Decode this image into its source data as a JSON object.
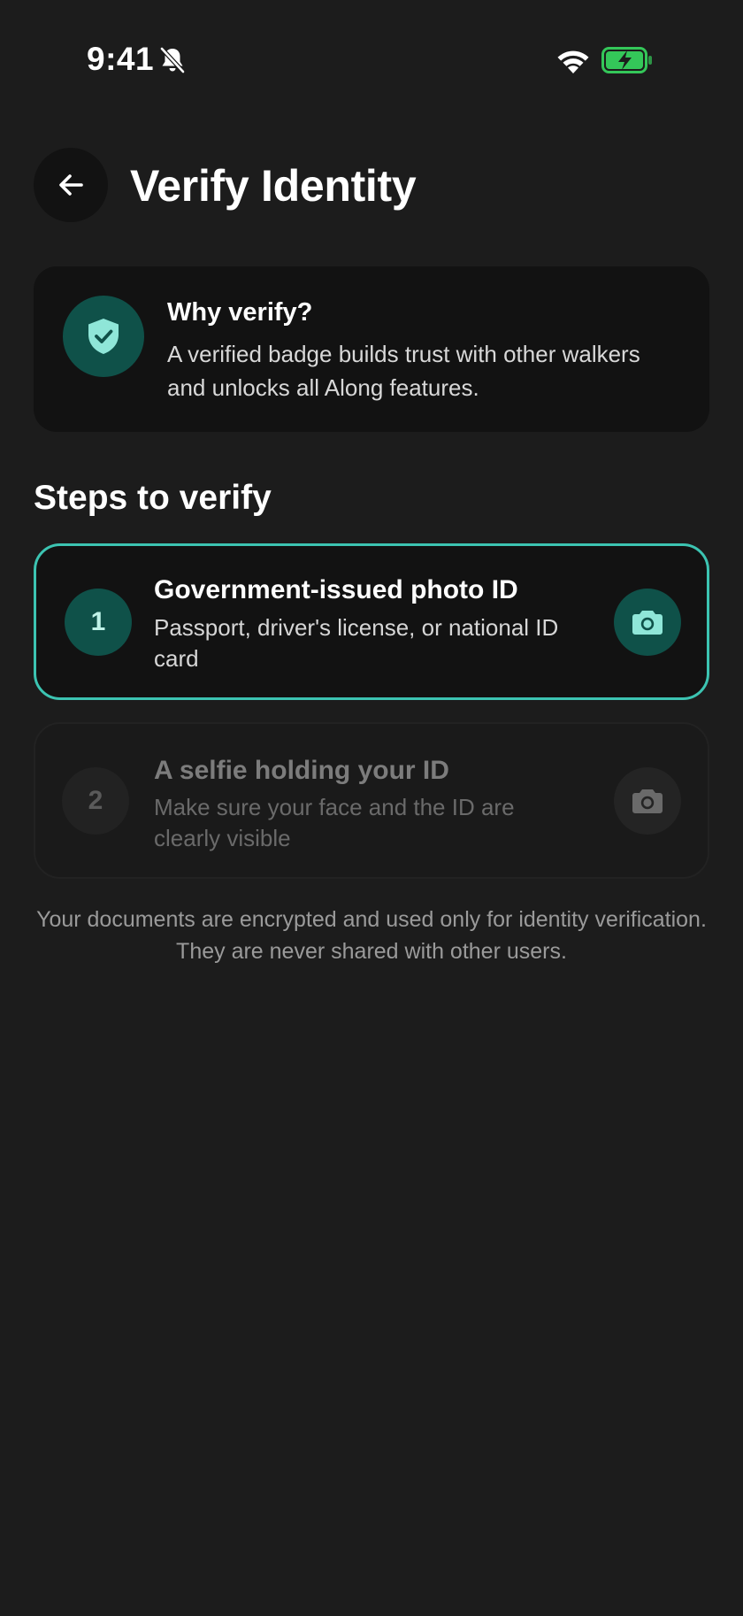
{
  "status_bar": {
    "time": "9:41",
    "icons": [
      "bell-slash-icon",
      "wifi-icon",
      "battery-charging-icon"
    ]
  },
  "header": {
    "back_icon": "arrow-left-icon",
    "title": "Verify Identity"
  },
  "info_card": {
    "icon": "shield-check-icon",
    "title": "Why verify?",
    "body": "A verified badge builds trust with other walkers and unlocks all Along features."
  },
  "steps_section": {
    "title": "Steps to verify",
    "steps": [
      {
        "number": "1",
        "title": "Government-issued photo ID",
        "description": "Passport, driver's license, or national ID card",
        "icon": "camera-icon",
        "state": "active"
      },
      {
        "number": "2",
        "title": "A selfie holding your ID",
        "description": "Make sure your face and the ID are clearly visible",
        "icon": "camera-icon",
        "state": "inactive"
      }
    ]
  },
  "footer_note": "Your documents are encrypted and used only for identity verification. They are never shared with other users.",
  "colors": {
    "background": "#1c1c1c",
    "card": "#121212",
    "accent": "#3cc4b2",
    "accent_dark": "#0f5149",
    "accent_light": "#8fe6d8",
    "battery_green": "#34c759"
  }
}
